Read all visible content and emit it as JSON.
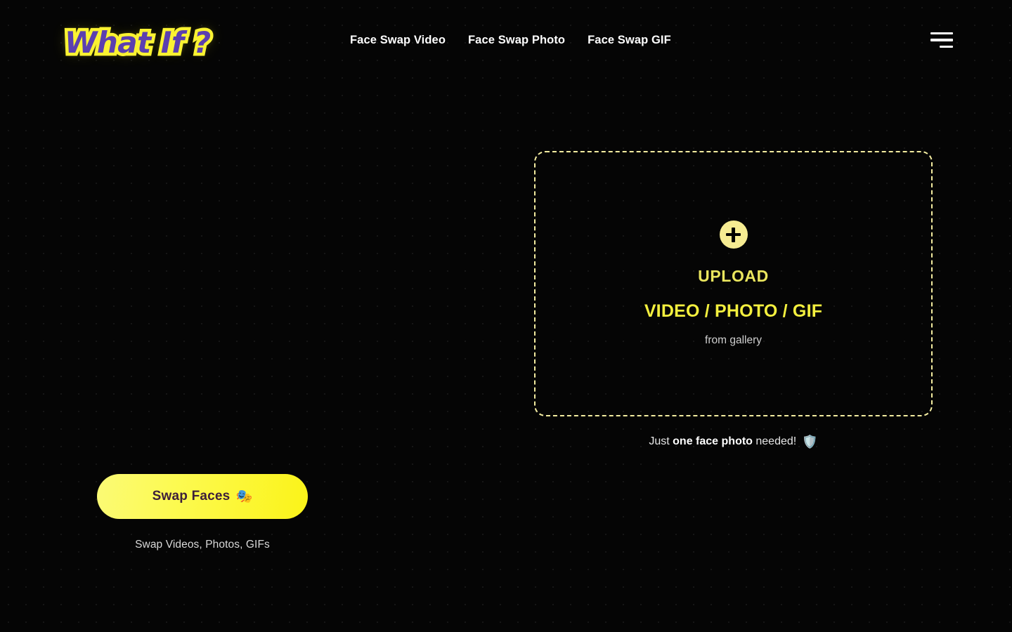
{
  "site": {
    "logo_text": "What If ?",
    "logo_fill_color": "#5b3fb0",
    "logo_stroke_color": "#fbf434",
    "background_color": "#050505",
    "accent_color": "#f3ef3e"
  },
  "header": {
    "nav": [
      {
        "label": "Face Swap Video",
        "name": "nav-face-swap-video"
      },
      {
        "label": "Face Swap Photo",
        "name": "nav-face-swap-photo"
      },
      {
        "label": "Face Swap GIF",
        "name": "nav-face-swap-gif"
      }
    ],
    "menu_icon": "hamburger-menu-icon"
  },
  "upload": {
    "plus_icon": "plus-icon",
    "title": "UPLOAD",
    "types": "VIDEO / PHOTO / GIF",
    "subtitle": "from gallery",
    "title_color": "#eae65e",
    "types_color": "#f3ef3e",
    "border_color": "#f3eca0"
  },
  "note": {
    "prefix": "Just ",
    "emphasis": "one face photo",
    "suffix": " needed!",
    "icon": "shield-check-icon",
    "icon_glyph": "🛡️"
  },
  "cta": {
    "button_label": "Swap Faces",
    "button_icon": "performing-arts-masks-icon",
    "button_icon_glyph": "🎭",
    "button_text_color": "#3d1f3a",
    "button_bg_color": "#fbf318",
    "caption": "Swap Videos, Photos, GIFs"
  }
}
